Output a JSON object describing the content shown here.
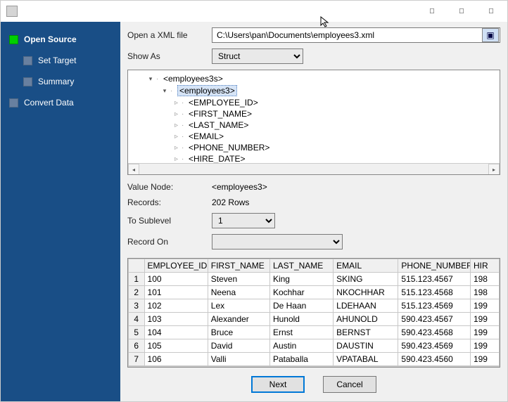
{
  "window": {
    "title": ""
  },
  "nav": {
    "open_source": "Open Source",
    "set_target": "Set Target",
    "summary": "Summary",
    "convert_data": "Convert Data"
  },
  "form": {
    "open_label": "Open a XML file",
    "path": "C:\\Users\\pan\\Documents\\employees3.xml",
    "show_as_label": "Show As",
    "show_as_value": "Struct",
    "value_node_label": "Value Node:",
    "value_node_value": "<employees3>",
    "records_label": "Records:",
    "records_value": "202 Rows",
    "to_sublevel_label": "To Sublevel",
    "to_sublevel_value": "1",
    "record_on_label": "Record On",
    "record_on_value": ""
  },
  "tree": {
    "root": "<employees3s>",
    "node1": "<employees3>",
    "f0": "<EMPLOYEE_ID>",
    "f1": "<FIRST_NAME>",
    "f2": "<LAST_NAME>",
    "f3": "<EMAIL>",
    "f4": "<PHONE_NUMBER>",
    "f5": "<HIRE_DATE>"
  },
  "columns": {
    "c1": "EMPLOYEE_ID",
    "c2": "FIRST_NAME",
    "c3": "LAST_NAME",
    "c4": "EMAIL",
    "c5": "PHONE_NUMBER",
    "c6": "HIR"
  },
  "rows": [
    {
      "n": "1",
      "id": "100",
      "fn": "Steven",
      "ln": "King",
      "em": "SKING",
      "ph": "515.123.4567",
      "hd": "198"
    },
    {
      "n": "2",
      "id": "101",
      "fn": "Neena",
      "ln": "Kochhar",
      "em": "NKOCHHAR",
      "ph": "515.123.4568",
      "hd": "198"
    },
    {
      "n": "3",
      "id": "102",
      "fn": "Lex",
      "ln": "De Haan",
      "em": "LDEHAAN",
      "ph": "515.123.4569",
      "hd": "199"
    },
    {
      "n": "4",
      "id": "103",
      "fn": "Alexander",
      "ln": "Hunold",
      "em": "AHUNOLD",
      "ph": "590.423.4567",
      "hd": "199"
    },
    {
      "n": "5",
      "id": "104",
      "fn": "Bruce",
      "ln": "Ernst",
      "em": "BERNST",
      "ph": "590.423.4568",
      "hd": "199"
    },
    {
      "n": "6",
      "id": "105",
      "fn": "David",
      "ln": "Austin",
      "em": "DAUSTIN",
      "ph": "590.423.4569",
      "hd": "199"
    },
    {
      "n": "7",
      "id": "106",
      "fn": "Valli",
      "ln": "Pataballa",
      "em": "VPATABAL",
      "ph": "590.423.4560",
      "hd": "199"
    }
  ],
  "buttons": {
    "next": "Next",
    "cancel": "Cancel"
  }
}
